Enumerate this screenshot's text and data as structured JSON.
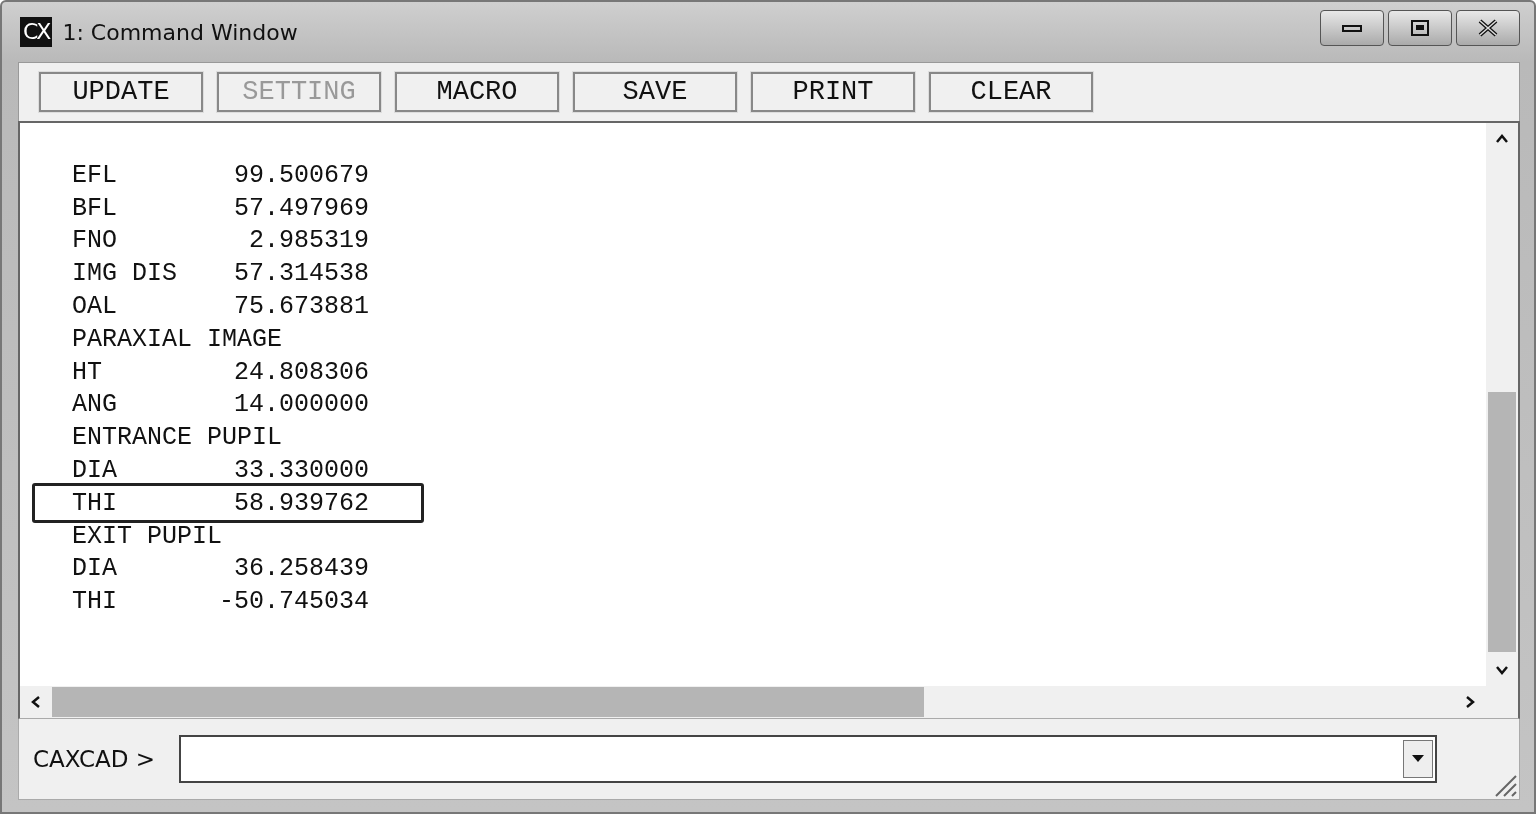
{
  "window": {
    "title": "1: Command Window",
    "app_icon": "CX"
  },
  "toolbar": [
    {
      "label": "UPDATE",
      "disabled": false
    },
    {
      "label": "SETTING",
      "disabled": true
    },
    {
      "label": "MACRO",
      "disabled": false
    },
    {
      "label": "SAVE",
      "disabled": false
    },
    {
      "label": "PRINT",
      "disabled": false
    },
    {
      "label": "CLEAR",
      "disabled": false
    }
  ],
  "output": [
    {
      "kind": "value",
      "label": "EFL",
      "value": "99.500679",
      "highlighted": false
    },
    {
      "kind": "value",
      "label": "BFL",
      "value": "57.497969",
      "highlighted": false
    },
    {
      "kind": "value",
      "label": "FNO",
      "value": "2.985319",
      "highlighted": false
    },
    {
      "kind": "value",
      "label": "IMG DIS",
      "value": "57.314538",
      "highlighted": false
    },
    {
      "kind": "value",
      "label": "OAL",
      "value": "75.673881",
      "highlighted": false
    },
    {
      "kind": "heading",
      "label": "PARAXIAL IMAGE",
      "highlighted": false
    },
    {
      "kind": "value",
      "label": "HT",
      "value": "24.808306",
      "highlighted": false
    },
    {
      "kind": "value",
      "label": "ANG",
      "value": "14.000000",
      "highlighted": false
    },
    {
      "kind": "heading",
      "label": "ENTRANCE PUPIL",
      "highlighted": false
    },
    {
      "kind": "value",
      "label": "DIA",
      "value": "33.330000",
      "highlighted": false
    },
    {
      "kind": "value",
      "label": "THI",
      "value": "58.939762",
      "highlighted": true
    },
    {
      "kind": "heading",
      "label": "EXIT PUPIL",
      "highlighted": false
    },
    {
      "kind": "value",
      "label": "DIA",
      "value": "36.258439",
      "highlighted": false
    },
    {
      "kind": "value",
      "label": "THI",
      "value": "-50.745034",
      "highlighted": false
    }
  ],
  "command": {
    "prompt": "CAXCAD >"
  }
}
